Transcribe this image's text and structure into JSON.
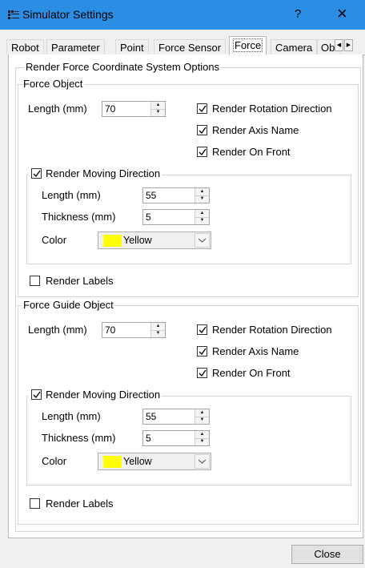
{
  "window": {
    "title": "Simulator Settings",
    "help_label": "?",
    "close_glyph": "×"
  },
  "tabs": [
    {
      "label": "Robot"
    },
    {
      "label": "Parameter"
    },
    {
      "label": "Point"
    },
    {
      "label": "Force Sensor"
    },
    {
      "label": "Force"
    },
    {
      "label": "Camera"
    },
    {
      "label": "Ob"
    }
  ],
  "active_tab": "Force",
  "section_title": "Render Force Coordinate System Options",
  "force_object": {
    "title": "Force Object",
    "length_label": "Length (mm)",
    "length_value": "70",
    "render_rotation_direction": {
      "label": "Render Rotation Direction",
      "checked": true
    },
    "render_axis_name": {
      "label": "Render Axis Name",
      "checked": true
    },
    "render_on_front": {
      "label": "Render On Front",
      "checked": true
    },
    "moving_direction": {
      "label": "Render Moving Direction",
      "checked": true,
      "length_label": "Length (mm)",
      "length_value": "55",
      "thickness_label": "Thickness (mm)",
      "thickness_value": "5",
      "color_label": "Color",
      "color_value": "Yellow",
      "color_hex": "#ffff00"
    },
    "render_labels": {
      "label": "Render Labels",
      "checked": false
    }
  },
  "force_guide_object": {
    "title": "Force Guide Object",
    "length_label": "Length (mm)",
    "length_value": "70",
    "render_rotation_direction": {
      "label": "Render Rotation Direction",
      "checked": true
    },
    "render_axis_name": {
      "label": "Render Axis Name",
      "checked": true
    },
    "render_on_front": {
      "label": "Render On Front",
      "checked": true
    },
    "moving_direction": {
      "label": "Render Moving Direction",
      "checked": true,
      "length_label": "Length (mm)",
      "length_value": "55",
      "thickness_label": "Thickness (mm)",
      "thickness_value": "5",
      "color_label": "Color",
      "color_value": "Yellow",
      "color_hex": "#ffff00"
    },
    "render_labels": {
      "label": "Render Labels",
      "checked": false
    }
  },
  "footer": {
    "close_label": "Close"
  },
  "colors": {
    "titlebar": "#2b8de3",
    "accent_yellow": "#ffff00"
  }
}
